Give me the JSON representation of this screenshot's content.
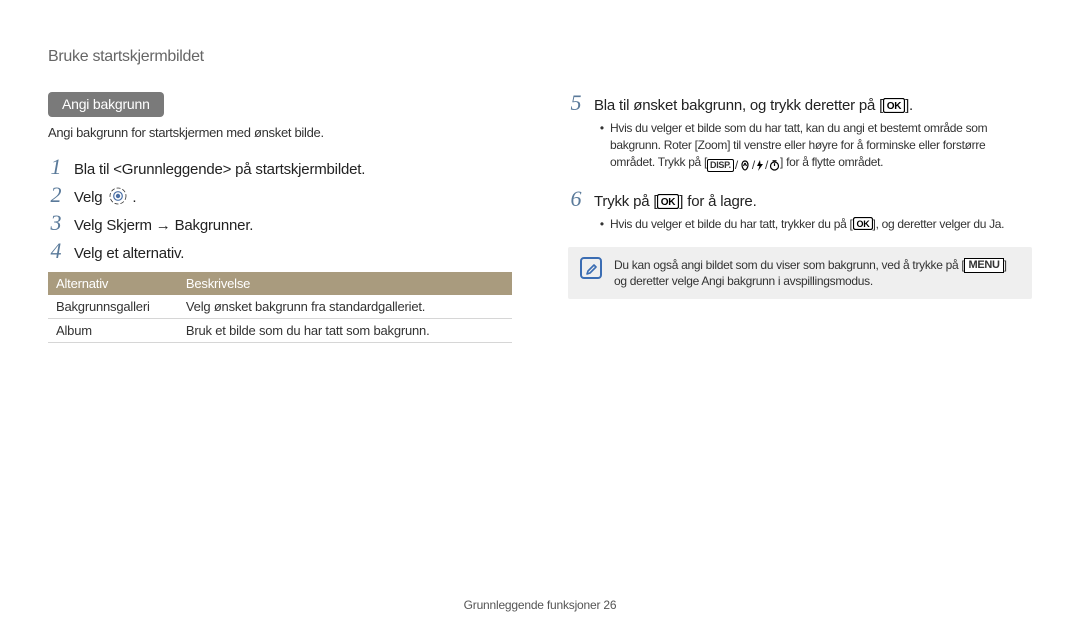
{
  "header": {
    "section_title": "Bruke startskjermbildet"
  },
  "left": {
    "tab": "Angi bakgrunn",
    "intro": "Angi bakgrunn for startskjermen med ønsket bilde.",
    "steps": {
      "s1": "Bla til <Grunnleggende> på startskjermbildet.",
      "s2": "Velg ",
      "s3": "Velg Skjerm → Bakgrunner.",
      "s4": "Velg et alternativ."
    },
    "table": {
      "h1": "Alternativ",
      "h2": "Beskrivelse",
      "r1c1": "Bakgrunnsgalleri",
      "r1c2": "Velg ønsket bakgrunn fra standardgalleriet.",
      "r2c1": "Album",
      "r2c2": "Bruk et bilde som du har tatt som bakgrunn."
    }
  },
  "right": {
    "step5_pre": "Bla til ønsket bakgrunn, og trykk deretter på [",
    "step5_post": "].",
    "step5_sub": "Hvis du velger et bilde som du har tatt, kan du angi et bestemt område som bakgrunn. Roter [Zoom] til venstre eller høyre for å forminske eller forstørre området. Trykk på [",
    "step5_sub_post": "] for å flytte området.",
    "step6_pre": "Trykk på [",
    "step6_mid": "] for å lagre.",
    "step6_sub_pre": "Hvis du velger et bilde du har tatt, trykker du på [",
    "step6_sub_post": "], og deretter velger du Ja.",
    "note_pre": "Du kan også angi bildet som du viser som bakgrunn, ved å trykke på [",
    "note_post": "] og deretter velge Angi bakgrunn i avspillingsmodus.",
    "menu_label": "MENU",
    "disp_label": "DISP."
  },
  "footer": {
    "text": "Grunnleggende funksjoner  26"
  }
}
